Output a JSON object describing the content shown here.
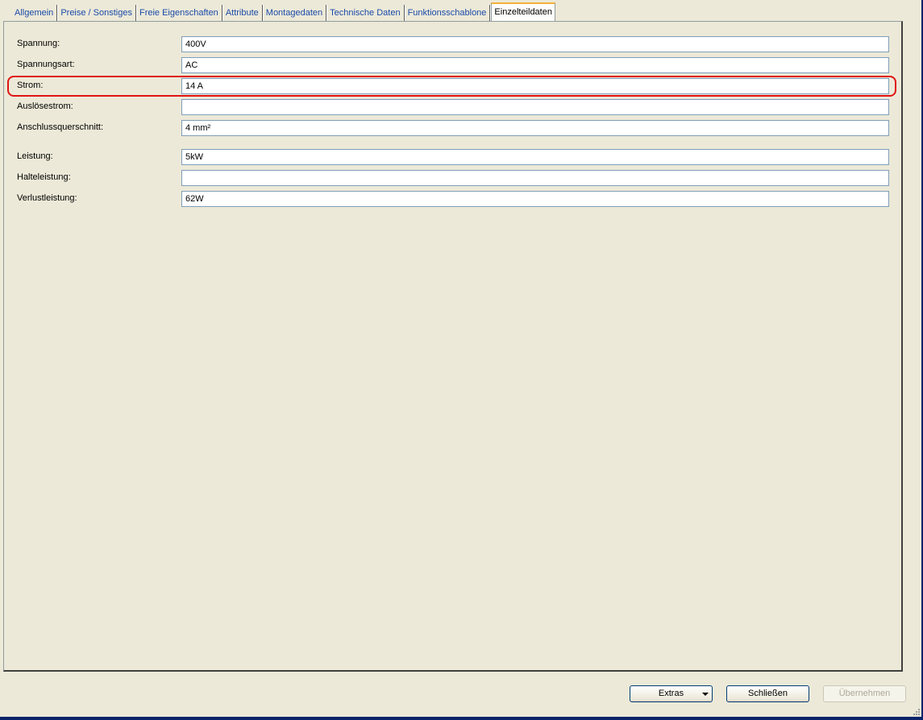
{
  "tabs": [
    {
      "label": "Allgemein"
    },
    {
      "label": "Preise / Sonstiges"
    },
    {
      "label": "Freie Eigenschaften"
    },
    {
      "label": "Attribute"
    },
    {
      "label": "Montagedaten"
    },
    {
      "label": "Technische Daten"
    },
    {
      "label": "Funktionsschablone"
    },
    {
      "label": "Einzelteildaten"
    }
  ],
  "fields": [
    {
      "label": "Spannung:",
      "value": "400V"
    },
    {
      "label": "Spannungsart:",
      "value": "AC"
    },
    {
      "label": "Strom:",
      "value": "14 A"
    },
    {
      "label": "Auslösestrom:",
      "value": ""
    },
    {
      "label": "Anschlussquerschnitt:",
      "value": "4 mm²"
    },
    {
      "label": "Leistung:",
      "value": "5kW"
    },
    {
      "label": "Halteleistung:",
      "value": ""
    },
    {
      "label": "Verlustleistung:",
      "value": "62W"
    }
  ],
  "buttons": {
    "extras": "Extras",
    "close": "Schließen",
    "apply": "Übernehmen"
  },
  "colors": {
    "highlight": "#e01414",
    "tab_link": "#1c4aa8",
    "background": "#ece9d8"
  }
}
